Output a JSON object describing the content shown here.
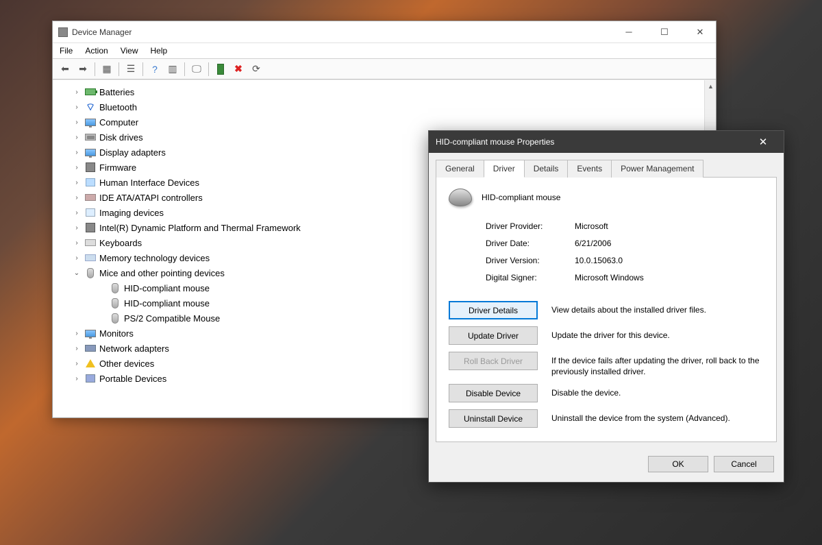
{
  "dm": {
    "title": "Device Manager",
    "menu": {
      "file": "File",
      "action": "Action",
      "view": "View",
      "help": "Help"
    },
    "tree": [
      {
        "label": "Batteries",
        "icon": "battery"
      },
      {
        "label": "Bluetooth",
        "icon": "bt"
      },
      {
        "label": "Computer",
        "icon": "monitor"
      },
      {
        "label": "Disk drives",
        "icon": "disk"
      },
      {
        "label": "Display adapters",
        "icon": "monitor"
      },
      {
        "label": "Firmware",
        "icon": "chip"
      },
      {
        "label": "Human Interface Devices",
        "icon": "hid"
      },
      {
        "label": "IDE ATA/ATAPI controllers",
        "icon": "ide"
      },
      {
        "label": "Imaging devices",
        "icon": "cam"
      },
      {
        "label": "Intel(R) Dynamic Platform and Thermal Framework",
        "icon": "chip"
      },
      {
        "label": "Keyboards",
        "icon": "kbd"
      },
      {
        "label": "Memory technology devices",
        "icon": "mem"
      },
      {
        "label": "Mice and other pointing devices",
        "icon": "mouse",
        "expanded": true,
        "children": [
          {
            "label": "HID-compliant mouse",
            "icon": "mouse"
          },
          {
            "label": "HID-compliant mouse",
            "icon": "mouse"
          },
          {
            "label": "PS/2 Compatible Mouse",
            "icon": "mouse"
          }
        ]
      },
      {
        "label": "Monitors",
        "icon": "monitor"
      },
      {
        "label": "Network adapters",
        "icon": "nic"
      },
      {
        "label": "Other devices",
        "icon": "warn"
      },
      {
        "label": "Portable Devices",
        "icon": "port"
      }
    ]
  },
  "prop": {
    "title": "HID-compliant mouse Properties",
    "tabs": {
      "general": "General",
      "driver": "Driver",
      "details": "Details",
      "events": "Events",
      "power": "Power Management"
    },
    "device_name": "HID-compliant mouse",
    "info": {
      "provider_label": "Driver Provider:",
      "provider": "Microsoft",
      "date_label": "Driver Date:",
      "date": "6/21/2006",
      "version_label": "Driver Version:",
      "version": "10.0.15063.0",
      "signer_label": "Digital Signer:",
      "signer": "Microsoft Windows"
    },
    "actions": {
      "details_btn": "Driver Details",
      "details_desc": "View details about the installed driver files.",
      "update_btn": "Update Driver",
      "update_desc": "Update the driver for this device.",
      "rollback_btn": "Roll Back Driver",
      "rollback_desc": "If the device fails after updating the driver, roll back to the previously installed driver.",
      "disable_btn": "Disable Device",
      "disable_desc": "Disable the device.",
      "uninstall_btn": "Uninstall Device",
      "uninstall_desc": "Uninstall the device from the system (Advanced)."
    },
    "footer": {
      "ok": "OK",
      "cancel": "Cancel"
    }
  }
}
